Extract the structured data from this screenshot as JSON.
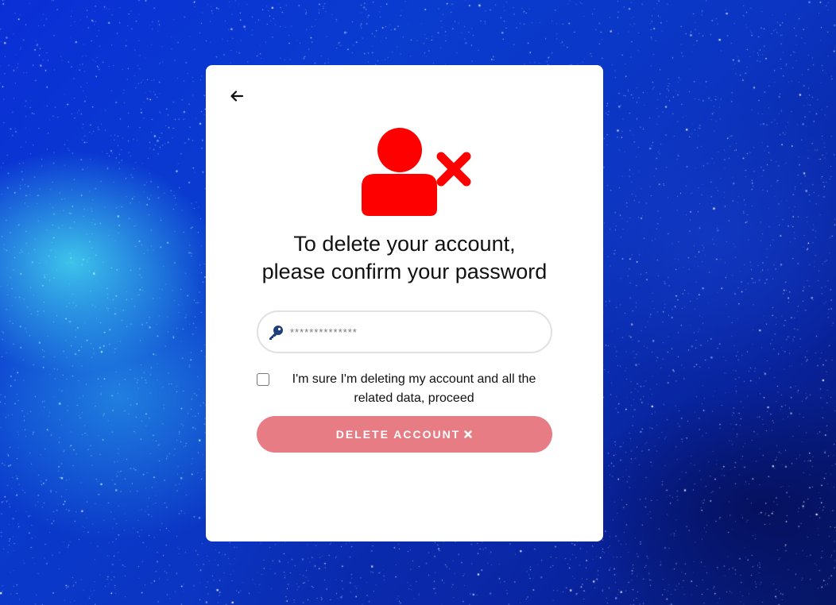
{
  "card": {
    "title_line1": "To delete your account,",
    "title_line2": "please confirm your password"
  },
  "back_button": {
    "icon": "arrow-left-icon"
  },
  "header_icon": {
    "name": "user-delete-icon",
    "color": "#ff0000"
  },
  "password": {
    "icon": "key-icon",
    "icon_color": "#1f3f7a",
    "value": "",
    "placeholder": "**************"
  },
  "confirm": {
    "checked": false,
    "label": "I'm sure I'm deleting my account and all the related data, proceed"
  },
  "delete_button": {
    "label": "DELETE ACCOUNT",
    "icon": "times-icon",
    "color": "#e77c85"
  }
}
